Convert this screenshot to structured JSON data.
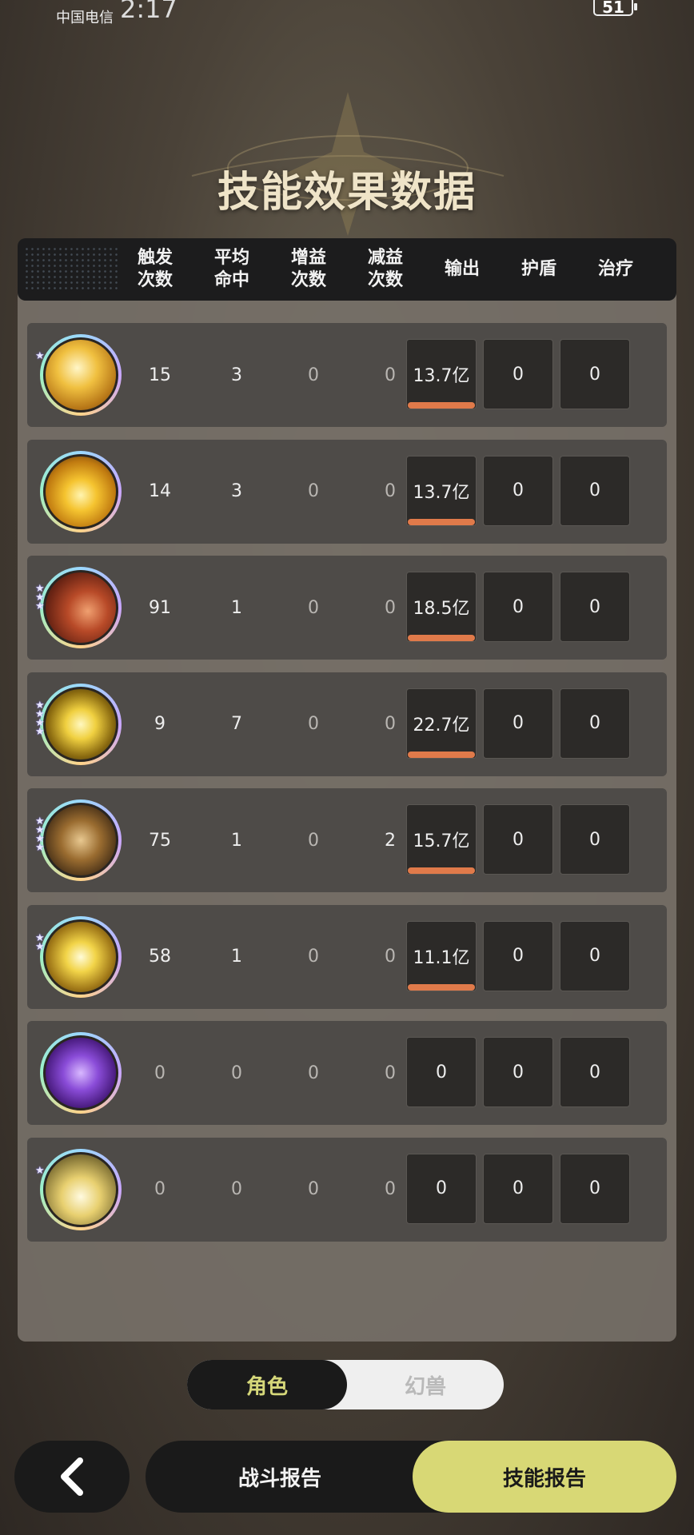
{
  "status": {
    "carrier": "中国电信",
    "time": "2:17",
    "battery": "51"
  },
  "title": "技能效果数据",
  "columns": [
    "触发\n次数",
    "平均\n命中",
    "增益\n次数",
    "减益\n次数",
    "输出",
    "护盾",
    "治疗"
  ],
  "rows": [
    {
      "icon": "skill-star-arrow-icon",
      "stars": 1,
      "trigger": "15",
      "avg_hit": "3",
      "buff": "0",
      "debuff": "0",
      "output": "13.7亿",
      "shield": "0",
      "heal": "0",
      "has_bar": true
    },
    {
      "icon": "skill-lightning-burst-icon",
      "stars": 0,
      "trigger": "14",
      "avg_hit": "3",
      "buff": "0",
      "debuff": "0",
      "output": "13.7亿",
      "shield": "0",
      "heal": "0",
      "has_bar": true
    },
    {
      "icon": "skill-meteor-icon",
      "stars": 3,
      "trigger": "91",
      "avg_hit": "1",
      "buff": "0",
      "debuff": "0",
      "output": "18.5亿",
      "shield": "0",
      "heal": "0",
      "has_bar": true
    },
    {
      "icon": "skill-thunder-orb-icon",
      "stars": 4,
      "trigger": "9",
      "avg_hit": "7",
      "buff": "0",
      "debuff": "0",
      "output": "22.7亿",
      "shield": "0",
      "heal": "0",
      "has_bar": true
    },
    {
      "icon": "skill-hammer-strike-icon",
      "stars": 4,
      "trigger": "75",
      "avg_hit": "1",
      "buff": "0",
      "debuff": "2",
      "output": "15.7亿",
      "shield": "0",
      "heal": "0",
      "has_bar": true
    },
    {
      "icon": "skill-radiant-burst-icon",
      "stars": 2,
      "trigger": "58",
      "avg_hit": "1",
      "buff": "0",
      "debuff": "0",
      "output": "11.1亿",
      "shield": "0",
      "heal": "0",
      "has_bar": true
    },
    {
      "icon": "skill-purple-vortex-icon",
      "stars": 0,
      "trigger": "0",
      "avg_hit": "0",
      "buff": "0",
      "debuff": "0",
      "output": "0",
      "shield": "0",
      "heal": "0",
      "has_bar": false
    },
    {
      "icon": "skill-golden-rise-icon",
      "stars": 1,
      "trigger": "0",
      "avg_hit": "0",
      "buff": "0",
      "debuff": "0",
      "output": "0",
      "shield": "0",
      "heal": "0",
      "has_bar": false
    }
  ],
  "toggle": {
    "active": "角色",
    "inactive": "幻兽"
  },
  "tabs": {
    "battle_report": "战斗报告",
    "skill_report": "技能报告"
  },
  "colors": {
    "accent": "#d8d875",
    "bar": "#e07a4a",
    "toggle_active_text": "#d6d87a"
  }
}
